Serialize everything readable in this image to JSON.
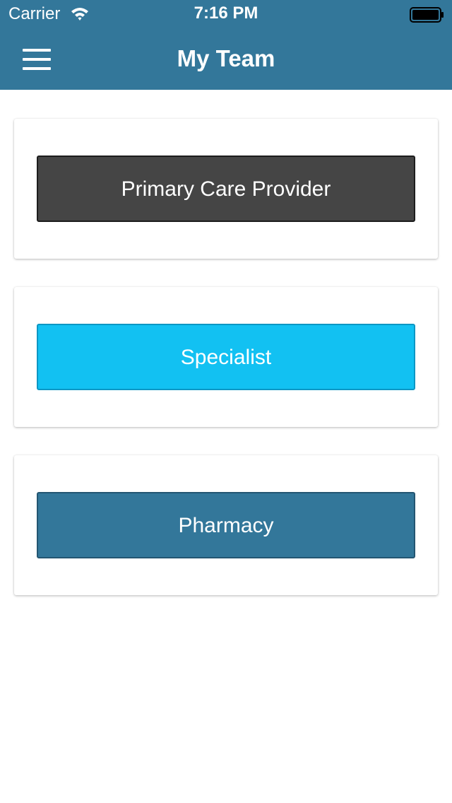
{
  "status_bar": {
    "carrier": "Carrier",
    "time": "7:16 PM",
    "wifi_icon": "wifi-icon",
    "battery_icon": "battery-icon"
  },
  "header": {
    "title": "My Team",
    "menu_icon": "hamburger-menu-icon",
    "background_color": "#33779a"
  },
  "cards": [
    {
      "label": "Primary Care Provider",
      "color": "#454545"
    },
    {
      "label": "Specialist",
      "color": "#12c1f2"
    },
    {
      "label": "Pharmacy",
      "color": "#33779a"
    }
  ]
}
